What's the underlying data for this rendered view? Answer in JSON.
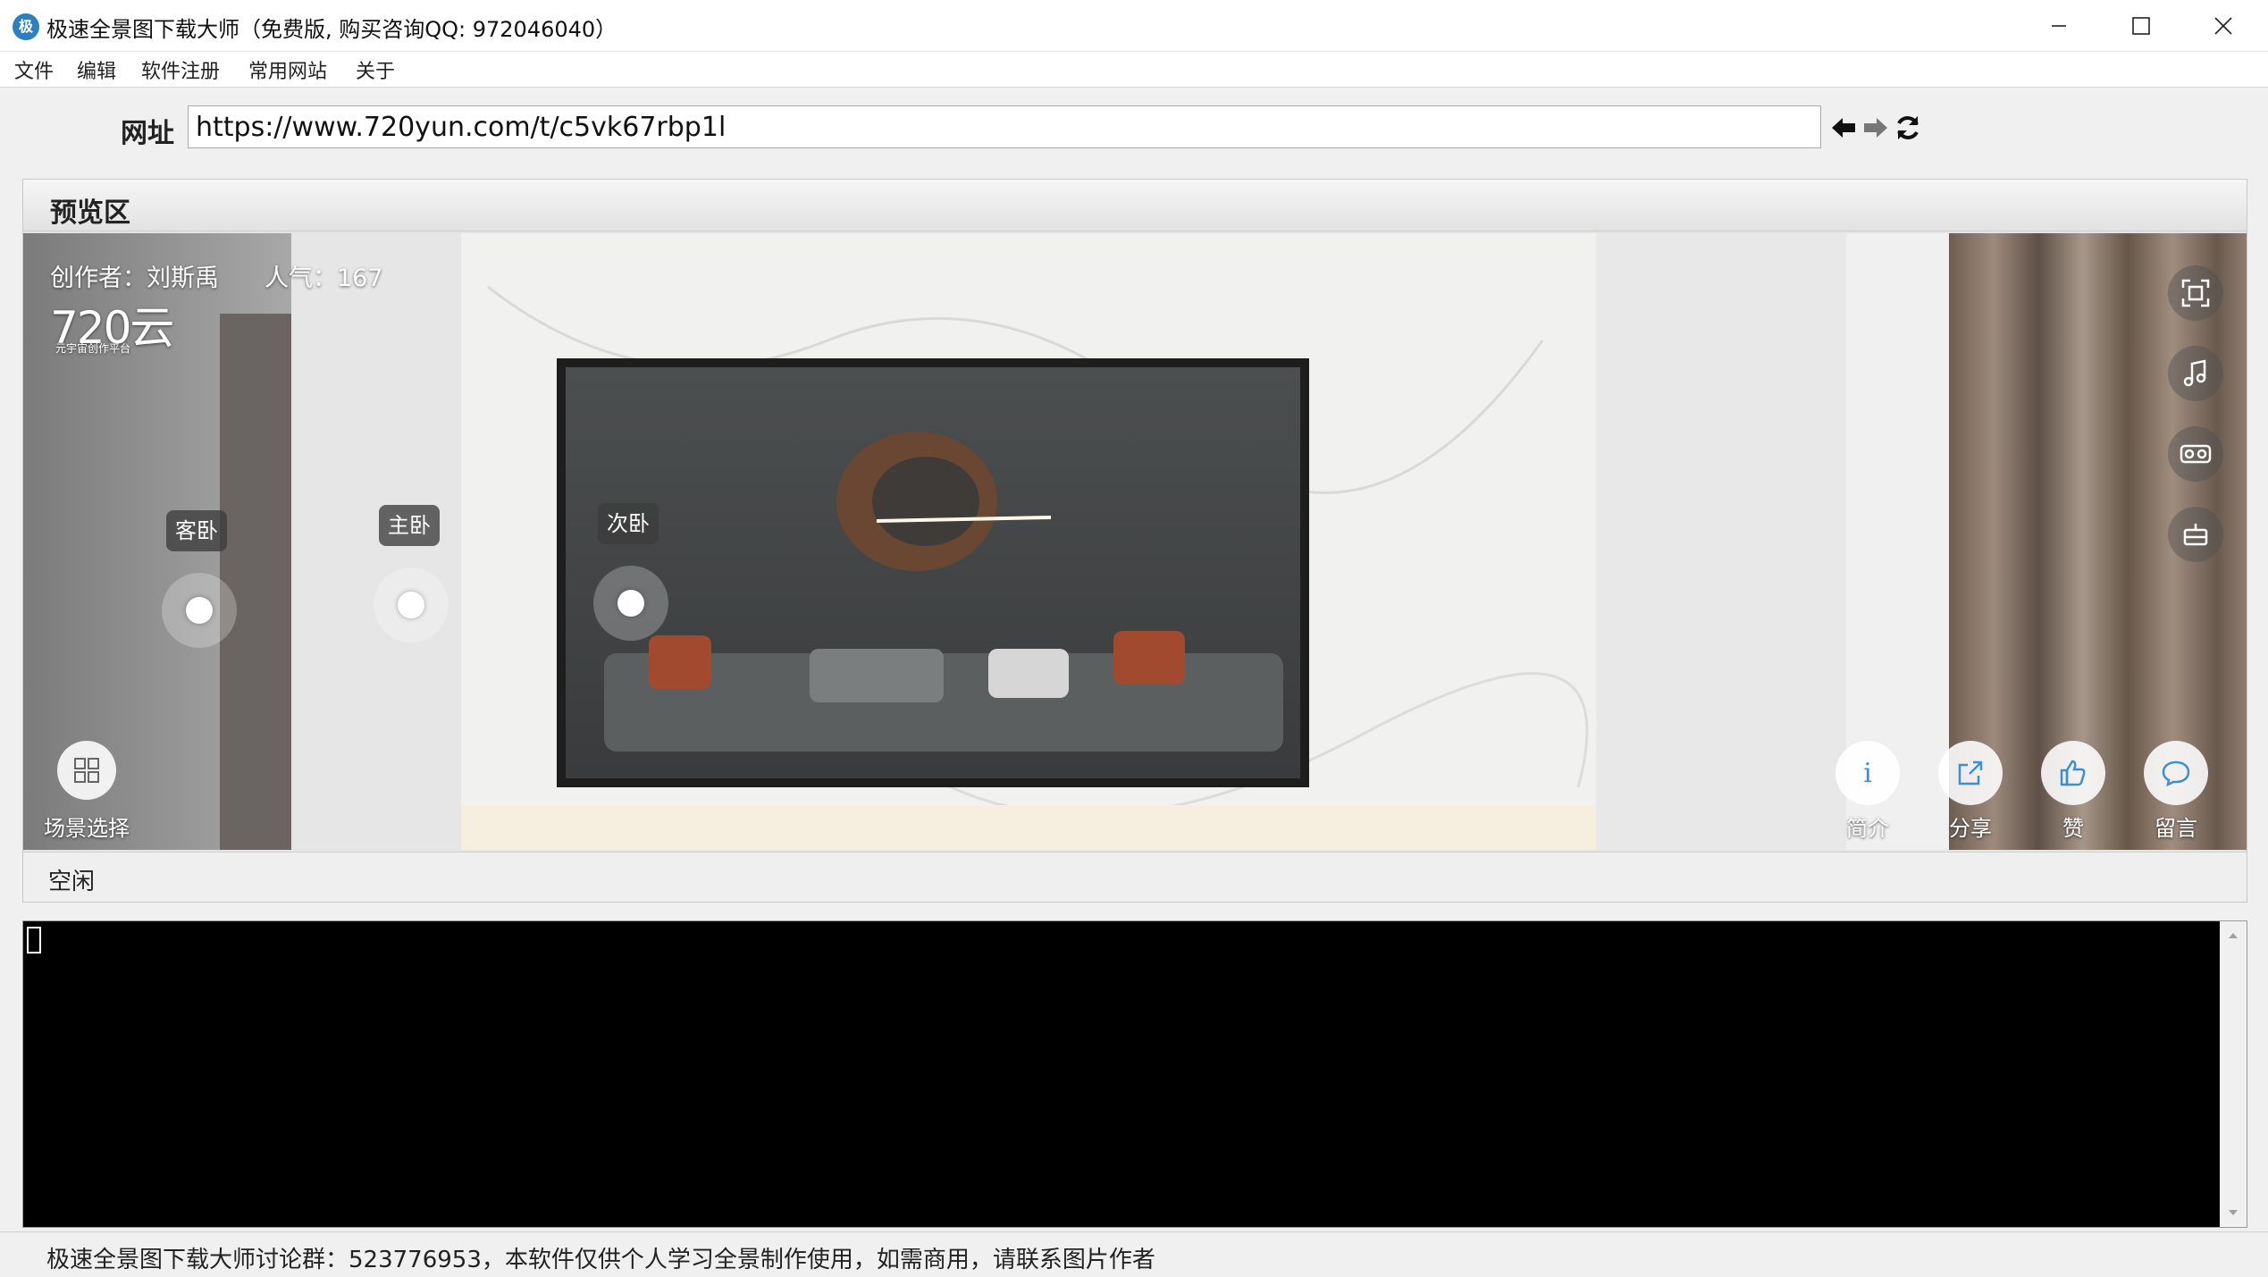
{
  "window": {
    "app_icon": "app-logo-icon",
    "title": "极速全景图下载大师（免费版, 购买咨询QQ: 972046040）",
    "controls": [
      "minimize-icon",
      "maximize-icon",
      "close-icon"
    ]
  },
  "menu": {
    "items": [
      {
        "label": "文件"
      },
      {
        "label": "编辑"
      },
      {
        "label": "软件注册"
      },
      {
        "label": "常用网站"
      },
      {
        "label": "关于"
      }
    ]
  },
  "urlbar": {
    "label": "网址",
    "value": "https://www.720yun.com/t/c5vk67rbp1l",
    "buttons": [
      "back-arrow-icon",
      "forward-arrow-icon",
      "refresh-icon"
    ]
  },
  "preview": {
    "title": "预览区",
    "author": "创作者：刘斯禹",
    "popularity": "人气：167",
    "logo_main": "720云",
    "logo_sub": "元宇宙创作平台",
    "hotspots": [
      {
        "label": "客卧"
      },
      {
        "label": "主卧"
      },
      {
        "label": "次卧"
      }
    ],
    "right_tools": [
      "fullscreen-icon",
      "music-icon",
      "vr-glasses-icon",
      "robot-icon"
    ],
    "scene_select": "场景选择",
    "bottom_buttons": [
      {
        "label": "简介",
        "icon": "info-icon"
      },
      {
        "label": "分享",
        "icon": "share-icon"
      },
      {
        "label": "赞",
        "icon": "thumbs-up-icon"
      },
      {
        "label": "留言",
        "icon": "comment-icon"
      }
    ],
    "status": "空闲"
  },
  "footer": {
    "text": "极速全景图下载大师讨论群：523776953，本软件仅供个人学习全景制作使用，如需商用，请联系图片作者"
  },
  "colors": {
    "accent_blue": "#2d7fbf",
    "console_bg": "#000000",
    "window_bg": "#f0f0f0"
  }
}
